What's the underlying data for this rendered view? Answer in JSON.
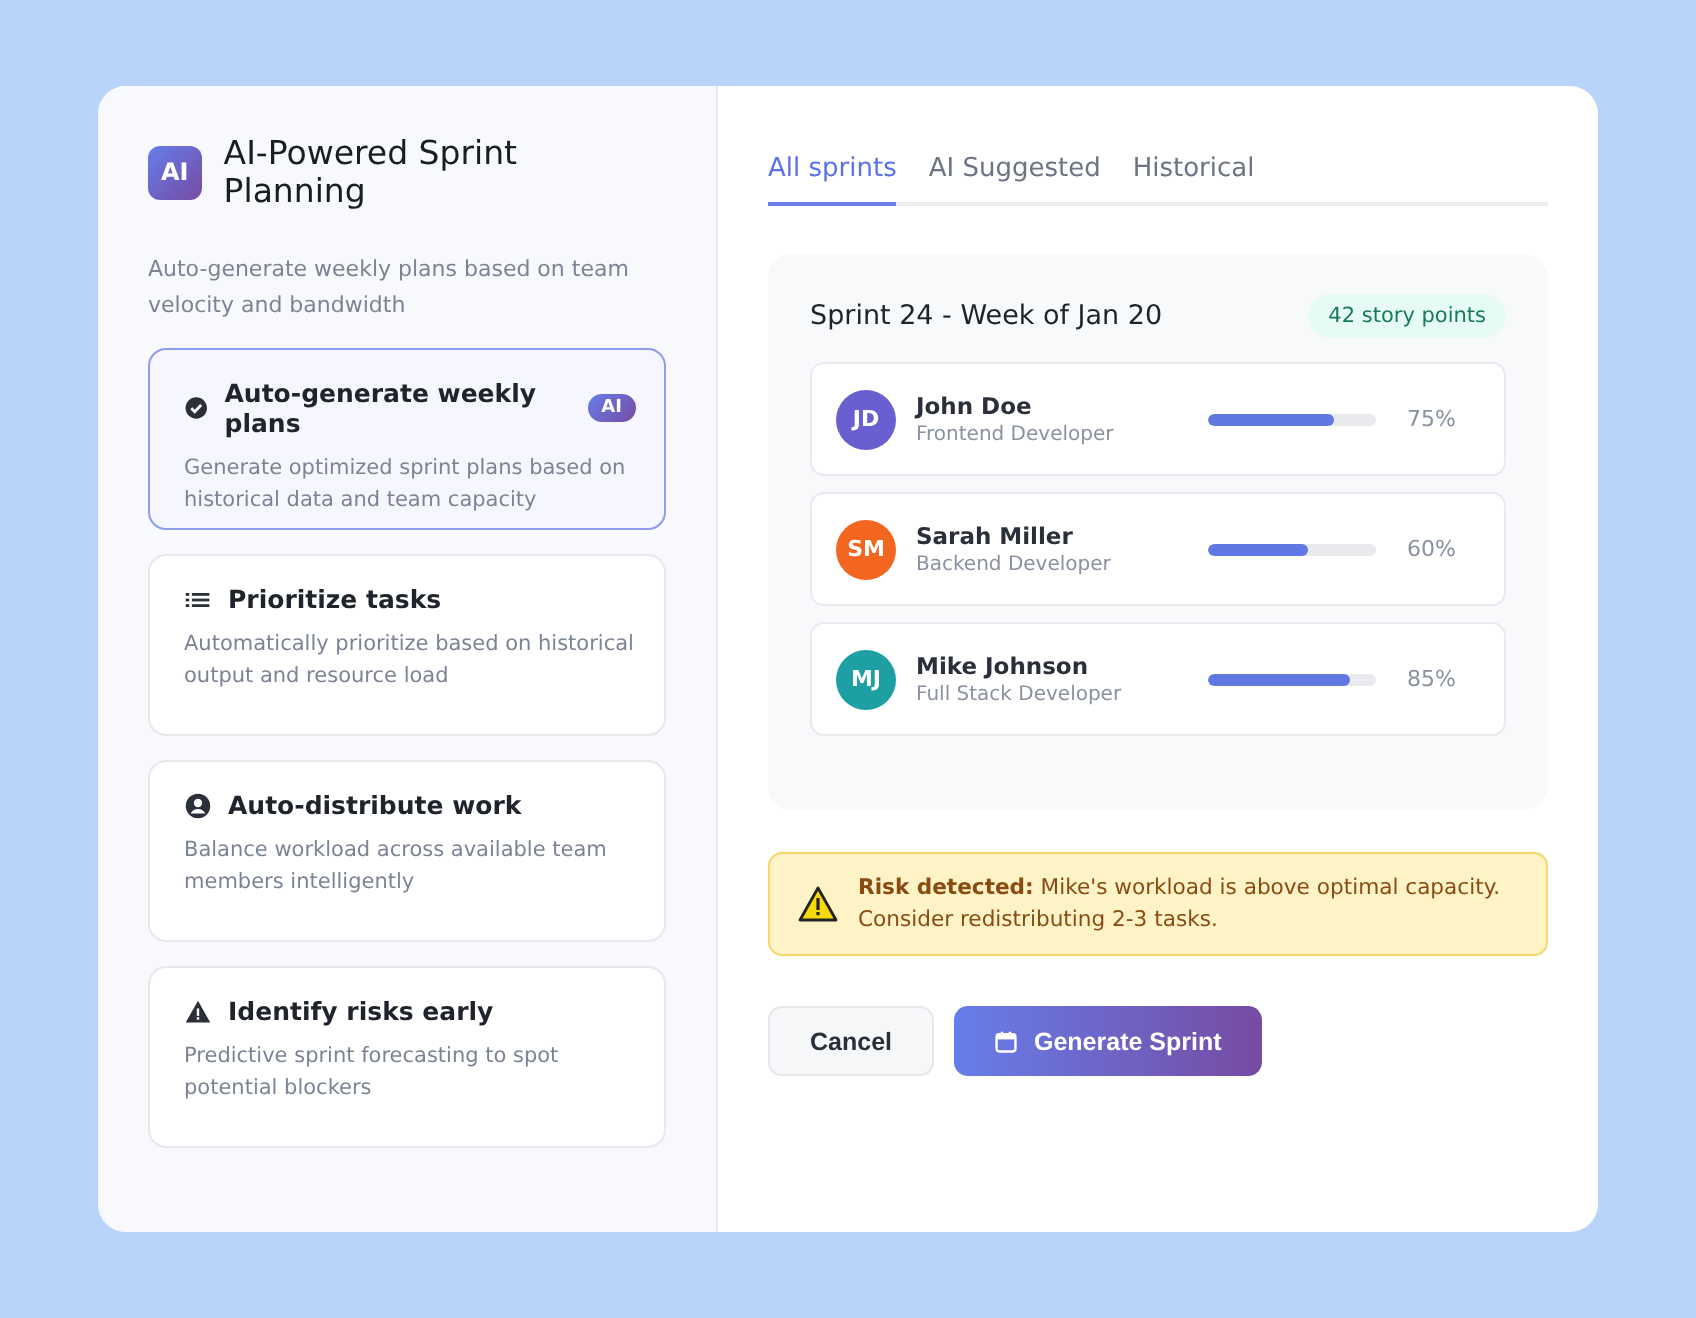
{
  "logo": "AI",
  "title": "AI-Powered Sprint Planning",
  "subtitle": "Auto-generate weekly plans based on team velocity and bandwidth",
  "features": [
    {
      "kind": "check",
      "title": "Auto-generate weekly plans",
      "badge": "AI",
      "description": "Generate optimized sprint plans based on historical data and team capacity",
      "selected": true
    },
    {
      "kind": "list",
      "title": "Prioritize tasks",
      "description": "Automatically prioritize based on historical output and resource load",
      "selected": false
    },
    {
      "kind": "user",
      "title": "Auto-distribute work",
      "description": "Balance workload across available team members intelligently",
      "selected": false
    },
    {
      "kind": "warning",
      "title": "Identify risks early",
      "description": "Predictive sprint forecasting to spot potential blockers",
      "selected": false
    }
  ],
  "tabs": [
    {
      "label": "All sprints",
      "selected": true
    },
    {
      "label": "AI Suggested",
      "selected": false
    },
    {
      "label": "Historical",
      "selected": false
    }
  ],
  "sprint": {
    "title": "Sprint 24 - Week of Jan 20",
    "points": "42 story points",
    "members": [
      {
        "initials": "JD",
        "name": "John Doe",
        "role": "Frontend Developer",
        "color": "#6a5fd0",
        "level": 0.75,
        "reading": "75%"
      },
      {
        "initials": "SM",
        "name": "Sarah Miller",
        "role": "Backend Developer",
        "color": "#f2661f",
        "level": 0.6,
        "reading": "60%"
      },
      {
        "initials": "MJ",
        "name": "Mike Johnson",
        "role": "Full Stack Developer",
        "color": "#1d9fa3",
        "level": 0.85,
        "reading": "85%"
      }
    ]
  },
  "alert": {
    "text": "**Risk detected:** Mike's workload is above optimal capacity. Consider redistributing 2-3 tasks."
  },
  "buttons": {
    "cancel": "Cancel",
    "generate": "Generate Sprint"
  }
}
